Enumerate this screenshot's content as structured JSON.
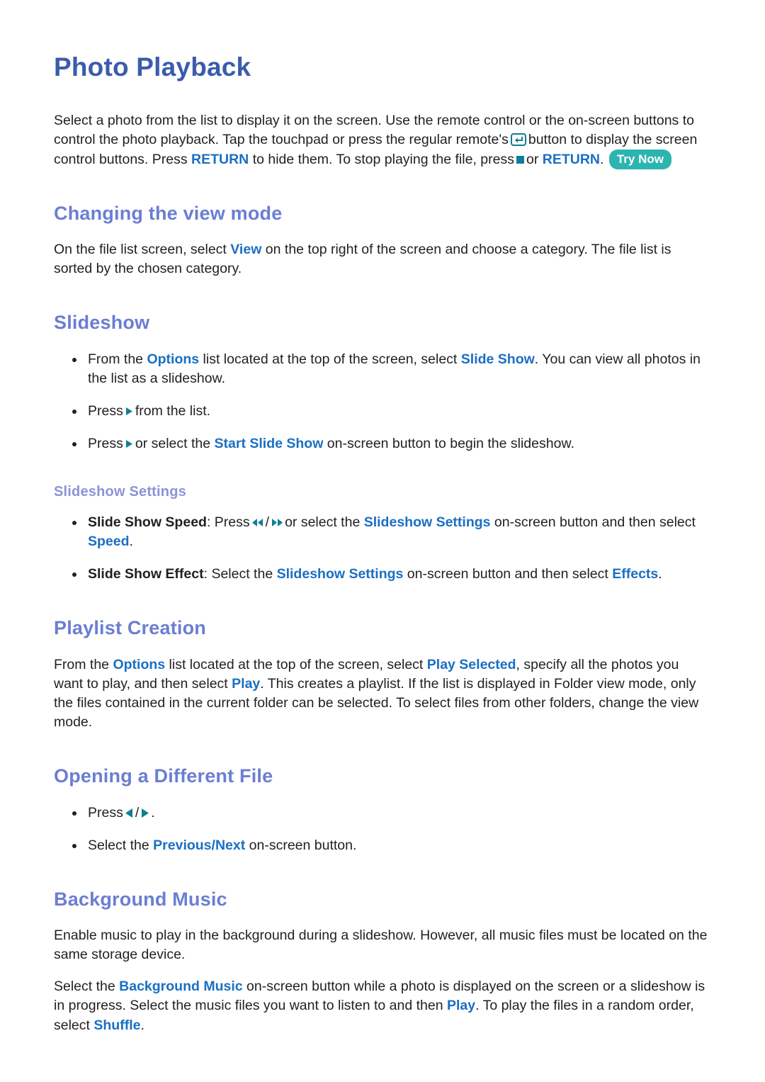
{
  "document": {
    "title": "Photo Playback",
    "intro": {
      "part1": "Select a photo from the list to display it on the screen. Use the remote control or the on-screen buttons to control the photo playback. Tap the touchpad or press the regular remote's",
      "part2": "button to display the screen control buttons. Press",
      "return_link_1": "RETURN",
      "part3": "to hide them. To stop playing the file, press",
      "part4": "or",
      "return_link_2": "RETURN",
      "period": ".",
      "try_now_badge": "Try Now"
    }
  },
  "sections": {
    "view_mode": {
      "heading": "Changing the view mode",
      "body_part1": "On the file list screen, select",
      "view_link": "View",
      "body_part2": "on the top right of the screen and choose a category. The file list is sorted by the chosen category."
    },
    "slideshow": {
      "heading": "Slideshow",
      "bullets": [
        {
          "part1": "From the",
          "link1": "Options",
          "part2": "list located at the top of the screen, select",
          "link2": "Slide Show",
          "part3": ". You can view all photos in the list as a slideshow."
        },
        {
          "part1": "Press",
          "icon": "play-icon",
          "part2": "from the list."
        },
        {
          "part1": "Press",
          "icon": "play-icon",
          "part2": "or select the",
          "link1": "Start Slide Show",
          "part3": "on-screen button to begin the slideshow."
        }
      ],
      "settings": {
        "heading": "Slideshow Settings",
        "bullets": [
          {
            "bold_label": "Slide Show Speed",
            "part1": ": Press",
            "icon_rew": "rewind-icon",
            "separator": "/",
            "icon_ff": "fast-forward-icon",
            "part2": "or select the",
            "link1": "Slideshow Settings",
            "part3": "on-screen button and then select",
            "link2": "Speed",
            "part4": "."
          },
          {
            "bold_label": "Slide Show Effect",
            "part1": ": Select the",
            "link1": "Slideshow Settings",
            "part2": "on-screen button and then select",
            "link2": "Effects",
            "part3": "."
          }
        ]
      }
    },
    "playlist": {
      "heading": "Playlist Creation",
      "part1": "From the",
      "link1": "Options",
      "part2": "list located at the top of the screen, select",
      "link2": "Play Selected",
      "part3": ", specify all the photos you want to play, and then select",
      "link3": "Play",
      "part4": ". This creates a playlist. If the list is displayed in Folder view mode, only the files contained in the current folder can be selected. To select files from other folders, change the view mode."
    },
    "opening_file": {
      "heading": "Opening a Different File",
      "bullets": [
        {
          "part1": "Press",
          "icon_prev": "previous-icon",
          "separator": "/",
          "icon_next": "next-icon",
          "part2": "."
        },
        {
          "part1": "Select the",
          "link1": "Previous/Next",
          "part2": "on-screen button."
        }
      ]
    },
    "background_music": {
      "heading": "Background Music",
      "paragraph1": "Enable music to play in the background during a slideshow. However, all music files must be located on the same storage device.",
      "paragraph2": {
        "part1": "Select the",
        "link1": "Background Music",
        "part2": "on-screen button while a photo is displayed on the screen or a slideshow is in progress. Select the music files you want to listen to and then",
        "link2": "Play",
        "part3": ". To play the files in a random order, select",
        "link3": "Shuffle",
        "part4": "."
      }
    }
  },
  "colors": {
    "doc_title": "#3a5cab",
    "section_heading": "#6b7ed2",
    "sub_heading": "#8b93d6",
    "inline_link": "#1a6fc4",
    "remote_glyph": "#0e7f96",
    "try_now_badge": "#2cb5b0",
    "body_text": "#231f20"
  }
}
